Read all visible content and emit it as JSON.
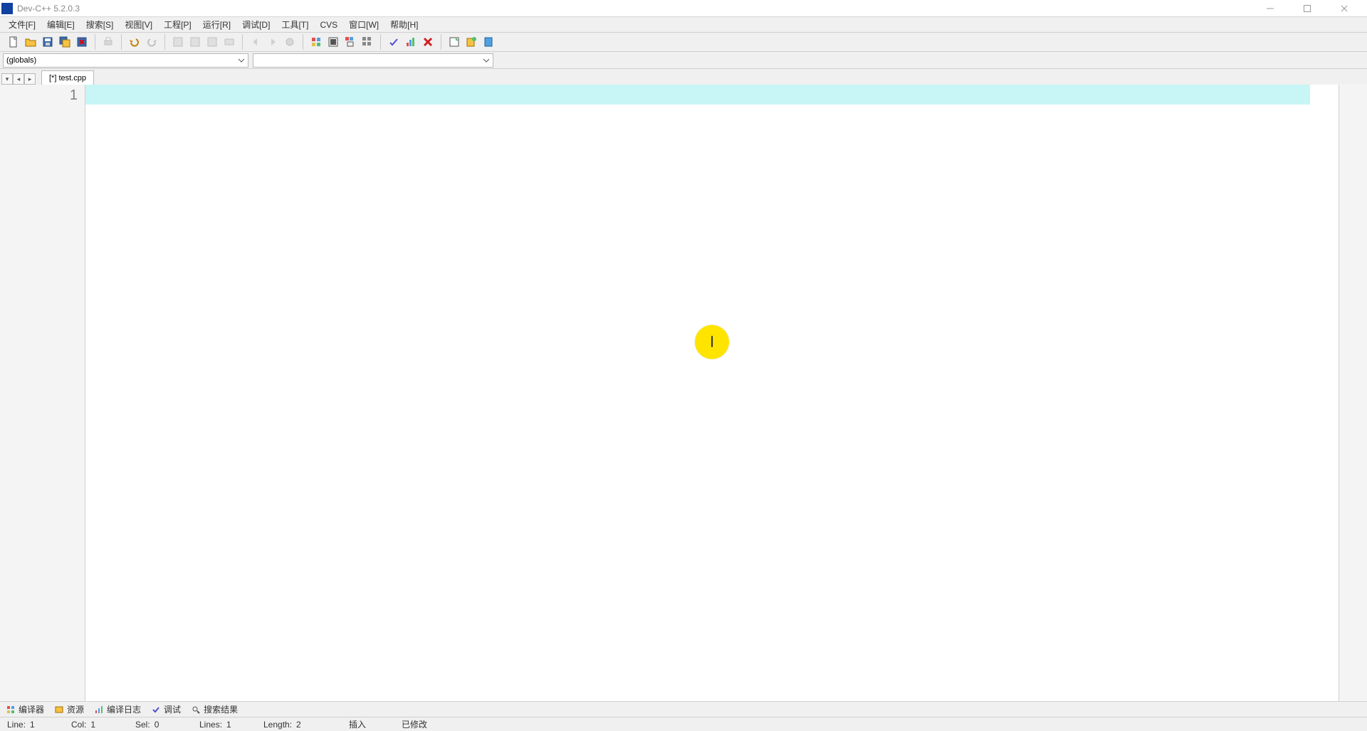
{
  "window": {
    "title": "Dev-C++ 5.2.0.3"
  },
  "menu": {
    "file": "文件[F]",
    "edit": "编辑[E]",
    "search": "搜索[S]",
    "view": "视图[V]",
    "project": "工程[P]",
    "run": "运行[R]",
    "debug": "调试[D]",
    "tools": "工具[T]",
    "cvs": "CVS",
    "window": "窗口[W]",
    "help": "帮助[H]"
  },
  "scope_selector": {
    "value": "(globals)"
  },
  "tabs": {
    "active": "[*] test.cpp"
  },
  "editor": {
    "line_numbers": [
      "1"
    ]
  },
  "bottom_tabs": {
    "compiler": "编译器",
    "resources": "资源",
    "compile_log": "编译日志",
    "debug": "调试",
    "search_results": "搜索结果"
  },
  "status": {
    "line_label": "Line:",
    "line_value": "1",
    "col_label": "Col:",
    "col_value": "1",
    "sel_label": "Sel:",
    "sel_value": "0",
    "lines_label": "Lines:",
    "lines_value": "1",
    "length_label": "Length:",
    "length_value": "2",
    "insert_mode": "插入",
    "modified": "已修改"
  },
  "cursor_marker": "I"
}
